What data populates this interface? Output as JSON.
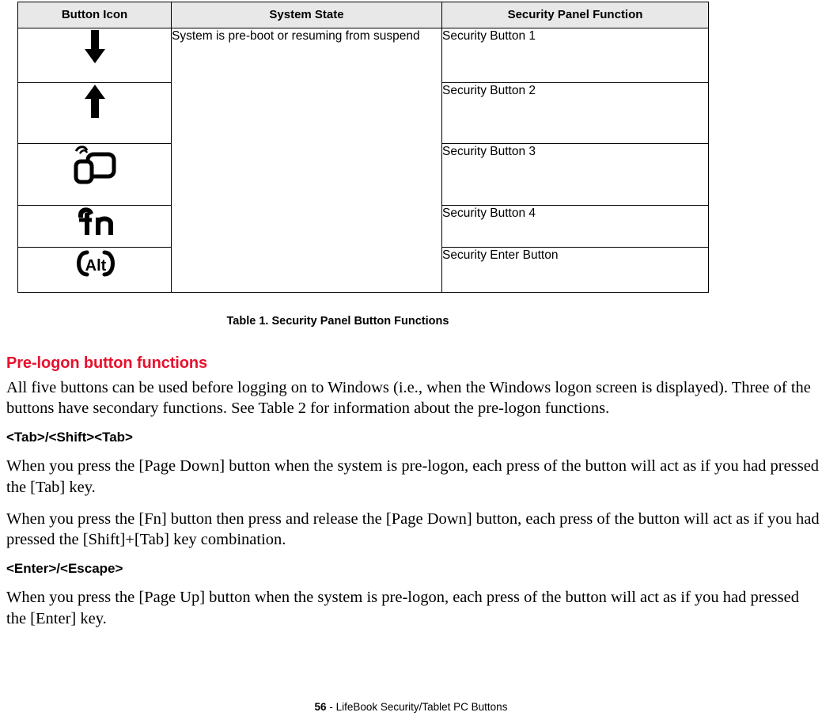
{
  "table": {
    "headers": [
      "Button Icon",
      "System State",
      "Security Panel Function"
    ],
    "rows": [
      {
        "icon": "down-arrow-icon",
        "state": "System is pre-boot or resuming from suspend",
        "function": "Security Button 1"
      },
      {
        "icon": "up-arrow-icon",
        "state": "",
        "function": "Security Button 2"
      },
      {
        "icon": "windows-screen-icon",
        "state": "",
        "function": "Security Button 3"
      },
      {
        "icon": "fn-key-icon",
        "state": "",
        "function": "Security Button 4"
      },
      {
        "icon": "alt-key-icon",
        "state": "",
        "function": "Security Enter Button"
      }
    ],
    "caption": "Table 1.  Security Panel Button Functions"
  },
  "content": {
    "heading": "Pre-logon button functions",
    "intro": "All five buttons can be used before logging on to Windows (i.e., when the Windows logon screen is displayed). Three of the buttons have secondary functions. See Table 2 for information about the pre-logon functions.",
    "sub1": "<Tab>/<Shift><Tab>",
    "p1": "When you press the [Page Down] button when the system is pre-logon, each press of the button will act as if you had pressed the [Tab] key.",
    "p2": "When you press the [Fn] button then press and release the [Page Down] button, each press of the button will act as if you had pressed the [Shift]+[Tab] key combination.",
    "sub2": "<Enter>/<Escape>",
    "p3": "When you press the [Page Up] button when the system is pre-logon, each press of the button will act as if you had pressed the [Enter] key."
  },
  "footer": {
    "page": "56",
    "text": " - LifeBook Security/Tablet PC Buttons"
  },
  "colors": {
    "accent": "#e8112d",
    "header_bg": "#e8e8e8",
    "border": "#000000"
  }
}
